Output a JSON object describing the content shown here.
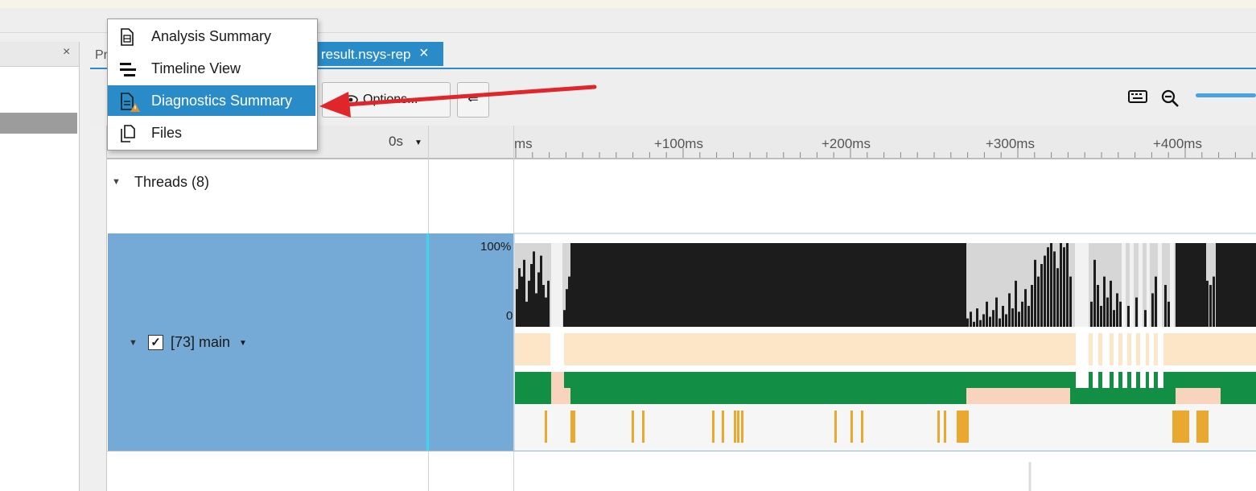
{
  "project_panel": {
    "tab_prefix": "Pr",
    "close_glyph": "×"
  },
  "tabs": {
    "active_label": "result.nsys-rep",
    "close_glyph": "×"
  },
  "toolbar": {
    "options_label": "Options...",
    "back_glyph": "⇐"
  },
  "menu": {
    "items": [
      {
        "label": "Analysis Summary",
        "icon": "report-icon"
      },
      {
        "label": "Timeline View",
        "icon": "timeline-icon"
      },
      {
        "label": "Diagnostics Summary",
        "icon": "diagnostics-warning-icon",
        "selected": true
      },
      {
        "label": "Files",
        "icon": "files-icon"
      }
    ]
  },
  "timeline": {
    "offset_label": "0s",
    "ruler_ticks": [
      "ms",
      "+100ms",
      "+200ms",
      "+300ms",
      "+400ms"
    ],
    "threads_label": "Threads (8)",
    "thread_name": "[73] main",
    "check_glyph": "✓",
    "axis_max": "100%",
    "axis_min": "0"
  },
  "colors": {
    "accent": "#2a8bc9",
    "selected_row": "#75aad6",
    "cpu_usage": "#1c1c1c",
    "os_runtime": "#fde6c8",
    "thread_state_running": "#138f45",
    "thread_state_waiting": "#f8d4bc",
    "api_calls": "#e9a830",
    "annotation_arrow": "#e0262a"
  }
}
